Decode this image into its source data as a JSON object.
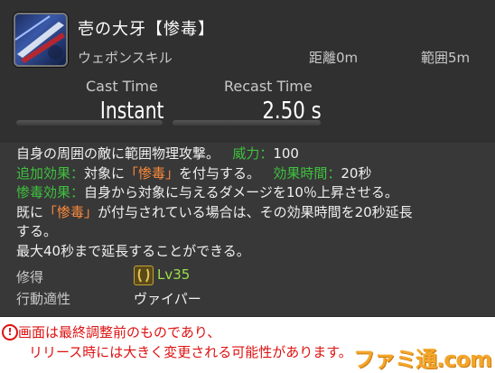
{
  "skill": {
    "name": "壱の大牙【惨毒】",
    "type": "ウェポンスキル",
    "distance": "距離0m",
    "range": "範囲5m",
    "cast_label": "Cast Time",
    "recast_label": "Recast Time",
    "cast_value": "Instant",
    "recast_value": "2.50 s"
  },
  "description": {
    "line1_text": "自身の周囲の敵に範囲物理攻撃。",
    "potency_label": "威力：",
    "potency_value": "100",
    "line2_label": "追加効果：",
    "line2_pre": "対象に",
    "line2_hl": "「惨毒」",
    "line2_post": "を付与する。",
    "duration_label": "効果時間：",
    "duration_value": "20秒",
    "line3_label": "惨毒効果：",
    "line3_text": "自身から対象に与えるダメージを10％上昇させる。",
    "line4_pre": "既に",
    "line4_hl": "「惨毒」",
    "line4_post": "が付与されている場合は、その効果時間を20秒延長",
    "line5": "する。",
    "line6": "最大40秒まで延長することができる。"
  },
  "meta": {
    "acquire_label": "修得",
    "acquire_level": "Lv35",
    "job_label": "行動適性",
    "job_value": "ヴァイパー"
  },
  "notice": {
    "line1": "画面は最終調整前のものであり、",
    "line2": "リリース時には大きく変更される可能性があります。"
  },
  "watermark": "ファミ通.com"
}
